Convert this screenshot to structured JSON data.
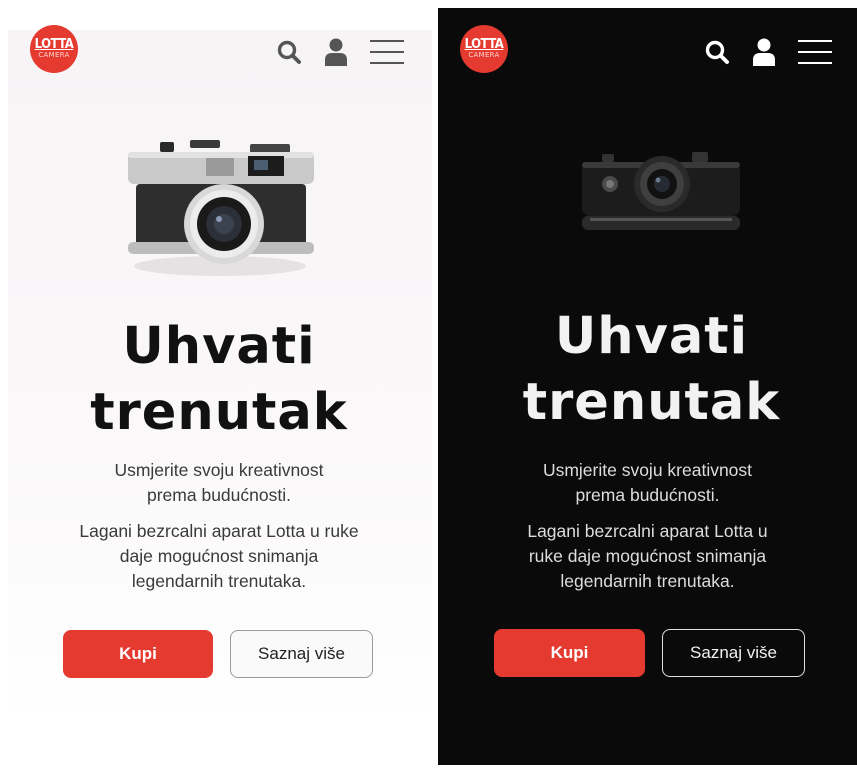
{
  "screens": [
    {
      "theme": "light",
      "brand": {
        "logo_main": "LOTTA",
        "logo_sub": "CAMERA",
        "color": "#e53a2f"
      },
      "nav": {
        "icons": [
          "search-icon",
          "user-icon",
          "menu-icon"
        ],
        "icon_color": "#555555"
      },
      "hero": {
        "title_line1": "Uhvati",
        "title_line2": "trenutak",
        "subtitle": "Usmjerite svoju kreativnost prema budućnosti.",
        "body": "Lagani bezrcalni aparat Lotta u ruke daje mogućnost snimanja legendarnih trenutaka."
      },
      "buttons": {
        "buy_label": "Kupi",
        "more_label": "Saznaj više"
      },
      "background": "#ffffff"
    },
    {
      "theme": "dark",
      "brand": {
        "logo_main": "LOTTA",
        "logo_sub": "CAMERA",
        "color": "#e53a2f"
      },
      "nav": {
        "icons": [
          "search-icon",
          "user-icon",
          "menu-icon"
        ],
        "icon_color": "#ffffff"
      },
      "hero": {
        "title_line1": "Uhvati",
        "title_line2": "trenutak",
        "subtitle": "Usmjerite svoju kreativnost prema budućnosti.",
        "body": "Lagani bezrcalni aparat Lotta u ruke daje mogućnost snimanja legendarnih trenutaka."
      },
      "buttons": {
        "buy_label": "Kupi",
        "more_label": "Saznaj više"
      },
      "background": "#0a0a0a"
    }
  ]
}
